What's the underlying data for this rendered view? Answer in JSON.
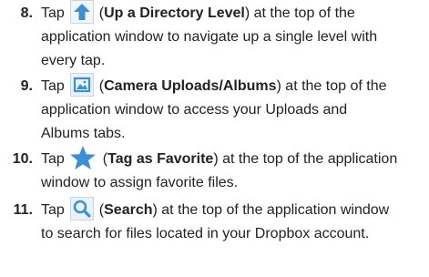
{
  "steps": [
    {
      "number": "8.",
      "tap": "Tap",
      "icon": "up-arrow-icon",
      "open_paren": "(",
      "label": "Up a Directory Level",
      "close_paren": ")",
      "rest_line1": " at the top of the",
      "line2": "application window to navigate up a single level with",
      "line3": "every tap."
    },
    {
      "number": "9.",
      "tap": "Tap",
      "icon": "camera-uploads-icon",
      "open_paren": "(",
      "label": "Camera Uploads/Albums",
      "close_paren": ")",
      "rest_line1": " at the top of the",
      "line2": "application window to access your Uploads and",
      "line3": "Albums tabs."
    },
    {
      "number": "10.",
      "tap": "Tap",
      "icon": "star-icon",
      "open_paren": "(",
      "label": "Tag as Favorite",
      "close_paren": ")",
      "rest_line1": " at the top of the application",
      "line2": "window to assign favorite files."
    },
    {
      "number": "11.",
      "tap": "Tap",
      "icon": "search-icon",
      "open_paren": "(",
      "label": "Search",
      "close_paren": ")",
      "rest_line1": " at the top of the application window",
      "line2": "to search for files located in your Dropbox account."
    }
  ],
  "colors": {
    "text": "#222222",
    "icon_blue": "#3b8fd8",
    "icon_bg": "#eaf2fa"
  }
}
